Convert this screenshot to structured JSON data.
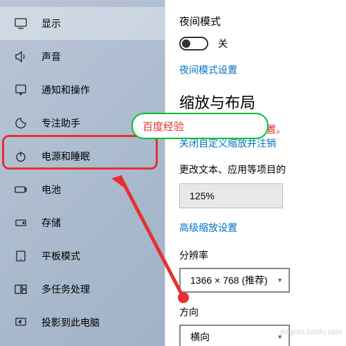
{
  "sidebar": {
    "items": [
      {
        "label": "显示",
        "icon": "monitor-icon"
      },
      {
        "label": "声音",
        "icon": "sound-icon"
      },
      {
        "label": "通知和操作",
        "icon": "notification-icon"
      },
      {
        "label": "专注助手",
        "icon": "focus-icon"
      },
      {
        "label": "电源和睡眠",
        "icon": "power-icon"
      },
      {
        "label": "电池",
        "icon": "battery-icon"
      },
      {
        "label": "存储",
        "icon": "storage-icon"
      },
      {
        "label": "平板模式",
        "icon": "tablet-icon"
      },
      {
        "label": "多任务处理",
        "icon": "multitask-icon"
      },
      {
        "label": "投影到此电脑",
        "icon": "project-icon"
      }
    ]
  },
  "callout": {
    "text": "百度经验"
  },
  "content": {
    "night_mode_label": "夜间模式",
    "toggle_state": "关",
    "night_mode_link": "夜间模式设置",
    "scale_heading": "缩放与布局",
    "custom_scale_warn": "自定义缩放比例已设置。",
    "custom_scale_link": "关闭自定义缩放并注销",
    "scale_desc": "更改文本、应用等项目的",
    "scale_value": "125%",
    "advanced_link": "高级缩放设置",
    "resolution_label": "分辨率",
    "resolution_value": "1366 × 768 (推荐)",
    "orientation_label": "方向",
    "orientation_value": "横向"
  },
  "watermark": "jingyan.baidu.com"
}
